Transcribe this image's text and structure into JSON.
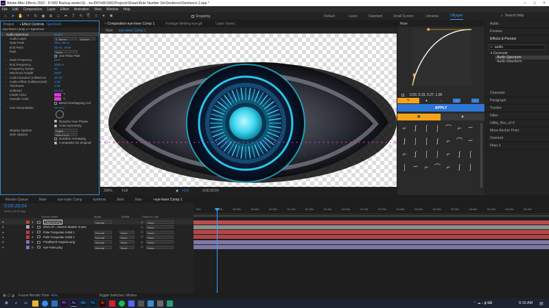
{
  "window": {
    "title": "Adobe After Effects 2022 - D:\\WD Backup.swdoc\\Sl... ee-f007e801081\\Projects\\Shaun\\Rule Number Six\\Sentience\\Sentience 2.aep *"
  },
  "menu": [
    "File",
    "Edit",
    "Composition",
    "Layer",
    "Effect",
    "Animation",
    "View",
    "Window",
    "Help"
  ],
  "toolbar": {
    "snapping": "Snapping"
  },
  "workspaces": [
    {
      "label": "Default",
      "active": false
    },
    {
      "label": "Learn",
      "active": false
    },
    {
      "label": "Standard",
      "active": false
    },
    {
      "label": "Small Screen",
      "active": false
    },
    {
      "label": "Libraries",
      "active": false
    },
    {
      "label": "Ollyuper",
      "active": true
    }
  ],
  "search_help": "Search Help",
  "left_panel": {
    "tabs": [
      "Project",
      "Effect Controls",
      "Spectrum"
    ],
    "header": "eye-lneer Comp 1 • Spectrum",
    "rows": [
      {
        "label": "Audio Spectrum",
        "value": "Reset",
        "indent": 0,
        "tri": true,
        "highlight": true
      },
      {
        "label": "Audio Layer",
        "value": "1. Spectr...",
        "indent": 1
      },
      {
        "label": "Start Point",
        "value": "8E0, 6BC2",
        "indent": 1
      },
      {
        "label": "End Point",
        "value": "9EAE, 4869",
        "indent": 1
      },
      {
        "label": "Path",
        "value": "None",
        "indent": 1
      },
      {
        "label": "",
        "value": "Use Polar Path",
        "indent": 1,
        "check": false
      },
      {
        "label": "Start Frequency",
        "value": "20.0",
        "indent": 1,
        "tri": true
      },
      {
        "label": "End Frequency",
        "value": "3000.0",
        "indent": 1,
        "tri": true
      },
      {
        "label": "Frequency bands",
        "value": "64",
        "indent": 1,
        "tri": true
      },
      {
        "label": "Maximum Height",
        "value": "4900",
        "indent": 1,
        "tri": true
      },
      {
        "label": "Audio Duration (millisecon",
        "value": "90.00",
        "indent": 1,
        "tri": true
      },
      {
        "label": "Audio Offset (milliseconds)",
        "value": "0.00",
        "indent": 1,
        "tri": true
      },
      {
        "label": "Thickness",
        "value": "3.00",
        "indent": 1,
        "tri": true
      },
      {
        "label": "Softness",
        "value": "50.0%",
        "indent": 1,
        "tri": true
      },
      {
        "label": "Inside Color",
        "value": "",
        "indent": 1,
        "swatch": "#d43bd1"
      },
      {
        "label": "Outside Color",
        "value": "",
        "indent": 1,
        "swatch": "#d43bd1"
      },
      {
        "label": "",
        "value": "Blend Overlapping Col",
        "indent": 1,
        "check": false
      },
      {
        "label": "Hue Interpolation",
        "value": "0x+0.0°",
        "indent": 1,
        "tri": true
      },
      {
        "label": "",
        "value": "",
        "indent": 1,
        "dial": true
      },
      {
        "label": "",
        "value": "Dynamic Hue Phase",
        "indent": 1,
        "check": true
      },
      {
        "label": "",
        "value": "Color Symmetry",
        "indent": 1,
        "check": true
      },
      {
        "label": "Display Options",
        "value": "Digital",
        "indent": 1
      },
      {
        "label": "Side Options",
        "value": "Side A & B",
        "indent": 1
      },
      {
        "label": "",
        "value": "Duration Averaging",
        "indent": 1,
        "check": false
      },
      {
        "label": "",
        "value": "Composite On Original",
        "indent": 1,
        "check": true
      }
    ]
  },
  "comp": {
    "tabs": [
      "Composition eye-lneer Comp 1",
      "Footage blinking-eye.gif",
      "Layer (none)"
    ],
    "breadcrumb": [
      "Main",
      "eye-lneer Comp 1"
    ],
    "viewer_bar": [
      "200%",
      "Full",
      "+0.0",
      "0:00:20:04"
    ],
    "spectrum_color": "#d43bd1"
  },
  "flow": {
    "title": "Flow",
    "values": "0.03, 0.19, 0.27, 1.00",
    "apply": "APPLY",
    "curve": [
      0.03,
      0.19,
      0.27,
      1.0
    ]
  },
  "right_col": {
    "items": [
      "Audio",
      "Preview",
      "Effects & Presets",
      "Character",
      "Paragraph",
      "Tracker",
      "Gifun",
      "Utility_Box_v2.6",
      "Move Anchor Point",
      "Overlord",
      "Fiber 3"
    ],
    "search_value": "audio",
    "tree": [
      "Generate",
      "Audio Spectrum",
      "Audio Waveform"
    ]
  },
  "timeline": {
    "tabs": [
      "Render Queue",
      "Main",
      "eye-outer Comp",
      "eyebrow",
      "blink",
      "links",
      "eye-lneer Comp 1"
    ],
    "timecode": "0:00:20:04",
    "fps": "00604 (30.00 fps)",
    "columns": [
      "Source Name",
      "Mode",
      "TrkMat",
      "Parent & Link"
    ],
    "ruler": [
      "00s",
      "00:15s",
      "00:30s",
      "00:45s",
      "01:00s",
      "01:15s",
      "01:30s",
      "01:45s",
      "02:00s",
      "02:15s",
      "02:30s",
      "02:45s",
      "03:00s",
      "03:15s",
      "03:30s",
      "03:45s",
      "04:00s",
      "04:15s",
      "04:30s"
    ],
    "layers": [
      {
        "num": "1",
        "name": "[Spectrum]",
        "mode": "Normal",
        "trkmat": "",
        "parent": "None",
        "color": "#c23b3b",
        "barcolor": "#b94c4c"
      },
      {
        "num": "2",
        "name": "2021.07...ntence Master 3.wav",
        "mode": "",
        "trkmat": "",
        "parent": "None",
        "color": "#a9a9a9",
        "barcolor": "#8d8d8d"
      },
      {
        "num": "3",
        "name": "Pale Turquoise Solid 1",
        "mode": "Normal",
        "trkmat": "None",
        "parent": "None",
        "color": "#c23b3b",
        "barcolor": "#b24848"
      },
      {
        "num": "4",
        "name": "Pale Turquoise Solid 1",
        "mode": "Normal",
        "trkmat": "None",
        "parent": "None",
        "color": "#c23b3b",
        "barcolor": "#ad4444"
      },
      {
        "num": "5",
        "name": "FinalEye3-nograin.png",
        "mode": "Normal",
        "trkmat": "None",
        "parent": "None",
        "color": "#7f77b3",
        "barcolor": "#7c78a6"
      },
      {
        "num": "6",
        "name": "eye-main.png",
        "mode": "Normal",
        "trkmat": "None",
        "parent": "None",
        "color": "#7f77b3",
        "barcolor": "#7c78a6"
      }
    ]
  },
  "status": {
    "left": "Frame Render Time",
    "render_time": "4ms",
    "center": "Toggle Switches / Modes"
  },
  "taskbar": {
    "time": "9:15 AM"
  }
}
